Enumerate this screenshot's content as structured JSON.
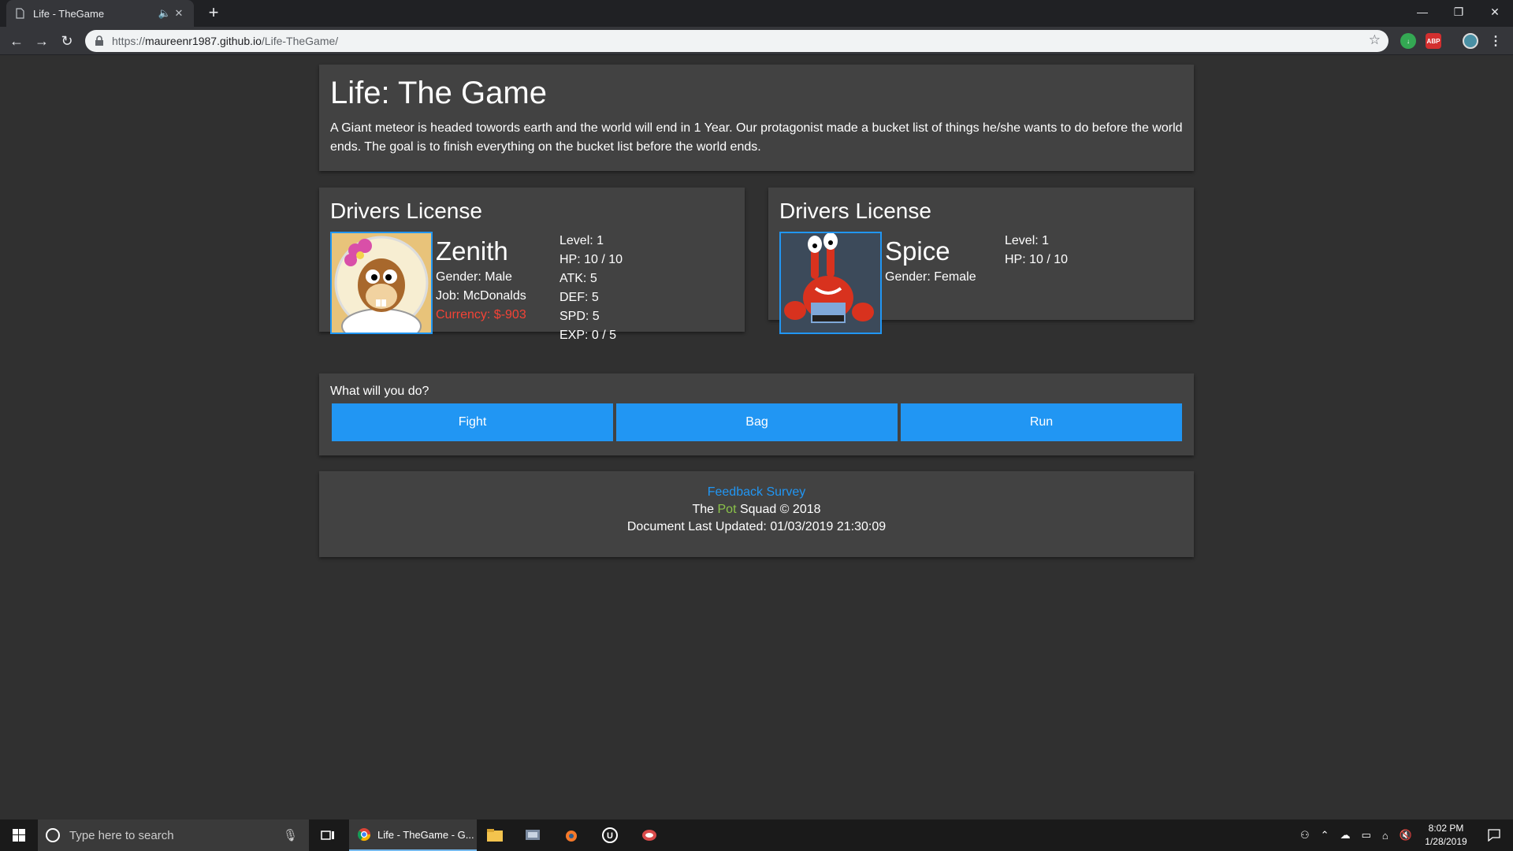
{
  "browser": {
    "tab_title": "Life - TheGame",
    "url_prefix": "https://",
    "url_host": "maureenr1987.github.io",
    "url_path": "/Life-TheGame/"
  },
  "header": {
    "title": "Life: The Game",
    "description": "A Giant meteor is headed towords earth and the world will end in 1 Year. Our protagonist made a bucket list of things he/she wants to do before the world ends. The goal is to finish everything on the bucket list before the world ends."
  },
  "player": {
    "card_title": "Drivers License",
    "name": "Zenith",
    "gender": "Gender: Male",
    "job": "Job: McDonalds",
    "currency": "Currency: $-903",
    "stats": [
      "Level: 1",
      "HP: 10 / 10",
      "ATK: 5",
      "DEF: 5",
      "SPD: 5",
      "EXP: 0 / 5"
    ]
  },
  "enemy": {
    "card_title": "Drivers License",
    "name": "Spice",
    "gender": "Gender: Female",
    "stats": [
      "Level: 1",
      "HP: 10 / 10"
    ]
  },
  "actions": {
    "prompt": "What will you do?",
    "fight": "Fight",
    "bag": "Bag",
    "run": "Run"
  },
  "footer": {
    "feedback_link": "Feedback Survey",
    "squad_the": "The",
    "squad_pot": "Pot",
    "squad_rest": "Squad © 2018",
    "last_updated": "Document Last Updated: 01/03/2019 21:30:09"
  },
  "taskbar": {
    "search_placeholder": "Type here to search",
    "chrome_label": "Life - TheGame - G...",
    "time": "8:02 PM",
    "date": "1/28/2019"
  },
  "colors": {
    "accent": "#2196f3",
    "currency": "#f44336",
    "pot": "#8bc34a",
    "card": "#424242",
    "background": "#303030"
  }
}
